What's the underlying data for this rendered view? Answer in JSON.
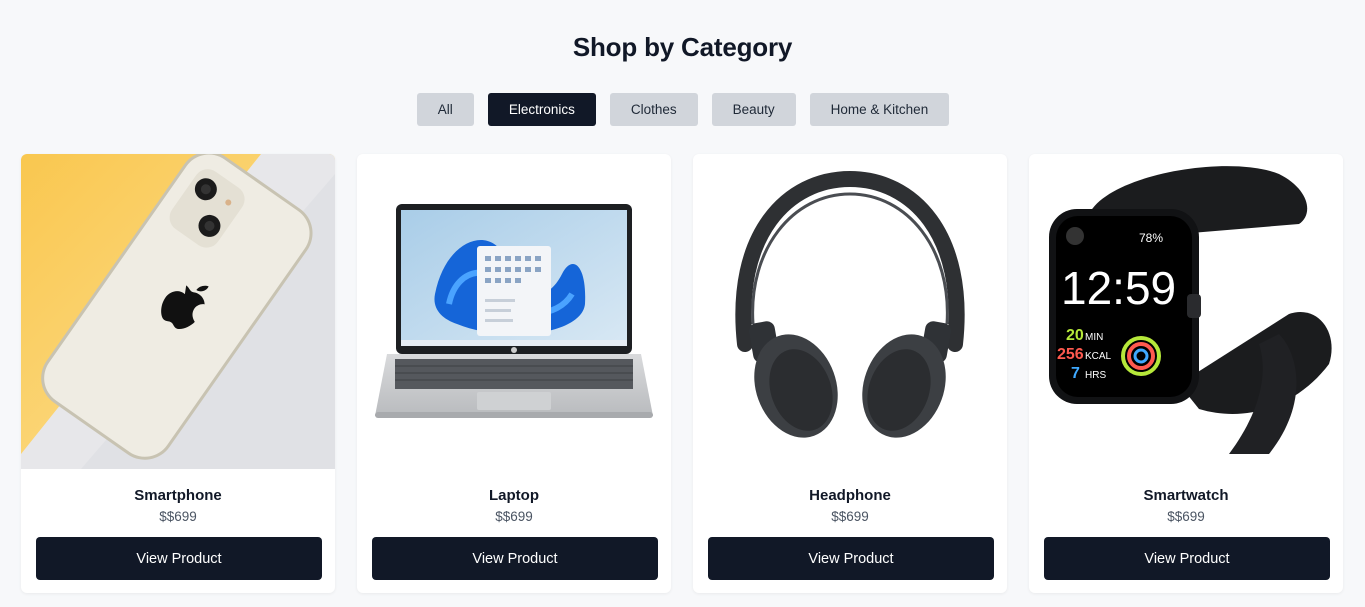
{
  "page_title": "Shop by Category",
  "filters": [
    {
      "label": "All",
      "active": false
    },
    {
      "label": "Electronics",
      "active": true
    },
    {
      "label": "Clothes",
      "active": false
    },
    {
      "label": "Beauty",
      "active": false
    },
    {
      "label": "Home & Kitchen",
      "active": false
    }
  ],
  "products": [
    {
      "name": "Smartphone",
      "price": "$$699",
      "button": "View Product",
      "icon": "smartphone-image"
    },
    {
      "name": "Laptop",
      "price": "$$699",
      "button": "View Product",
      "icon": "laptop-image"
    },
    {
      "name": "Headphone",
      "price": "$$699",
      "button": "View Product",
      "icon": "headphone-image"
    },
    {
      "name": "Smartwatch",
      "price": "$$699",
      "button": "View Product",
      "icon": "smartwatch-image"
    }
  ],
  "smartwatch_screen": {
    "battery": "78%",
    "time": "12:59",
    "stats": [
      {
        "value": "20",
        "unit": "MIN"
      },
      {
        "value": "256",
        "unit": "KCAL"
      },
      {
        "value": "7",
        "unit": "HRS"
      }
    ]
  },
  "colors": {
    "accent": "#111827",
    "chip_inactive": "#d1d5db",
    "background": "#f7f8fa"
  }
}
